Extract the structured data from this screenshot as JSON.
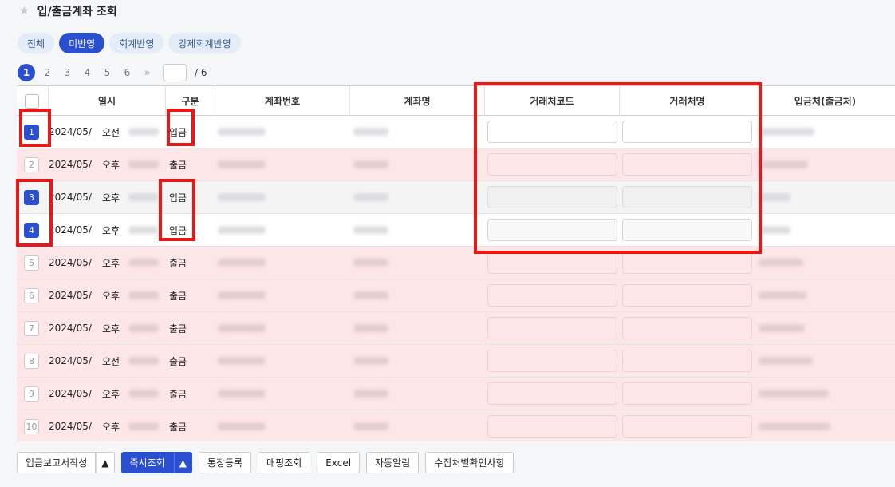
{
  "header": {
    "title": "입/출금계좌 조회",
    "star_icon": "star-icon"
  },
  "tabs": [
    "전체",
    "미반영",
    "회계반영",
    "강제회계반영"
  ],
  "active_tab": 1,
  "pager": {
    "pages": [
      "1",
      "2",
      "3",
      "4",
      "5",
      "6"
    ],
    "current": "1",
    "next": "»",
    "total": "/ 6",
    "input_value": ""
  },
  "columns": {
    "datetime": "일시",
    "type": "구분",
    "account_no": "계좌번호",
    "account_name": "계좌명",
    "partner_code": "거래처코드",
    "partner_name": "거래처명",
    "depositor": "입금처(출금처)"
  },
  "rows": [
    {
      "num": "1",
      "date": "2024/05/",
      "ampm": "오전",
      "type": "입금"
    },
    {
      "num": "2",
      "date": "2024/05/",
      "ampm": "오후",
      "type": "출금"
    },
    {
      "num": "3",
      "date": "2024/05/",
      "ampm": "오후",
      "type": "입금"
    },
    {
      "num": "4",
      "date": "2024/05/",
      "ampm": "오후",
      "type": "입금"
    },
    {
      "num": "5",
      "date": "2024/05/",
      "ampm": "오후",
      "type": "출금"
    },
    {
      "num": "6",
      "date": "2024/05/",
      "ampm": "오후",
      "type": "출금"
    },
    {
      "num": "7",
      "date": "2024/05/",
      "ampm": "오후",
      "type": "출금"
    },
    {
      "num": "8",
      "date": "2024/05/",
      "ampm": "오전",
      "type": "출금"
    },
    {
      "num": "9",
      "date": "2024/05/",
      "ampm": "오후",
      "type": "출금"
    },
    {
      "num": "10",
      "date": "2024/05/",
      "ampm": "오후",
      "type": "출금"
    }
  ],
  "buttons": {
    "deposit_report": "입금보고서작성",
    "instant_query": "즉시조회",
    "passbook_register": "통장등록",
    "mapping_query": "매핑조회",
    "excel": "Excel",
    "auto_alert": "자동알림",
    "collector_check": "수집처별확인사항"
  },
  "colors": {
    "accent": "#2a4fd0",
    "highlight": "#e81818",
    "row_pink": "#fde6e8"
  }
}
